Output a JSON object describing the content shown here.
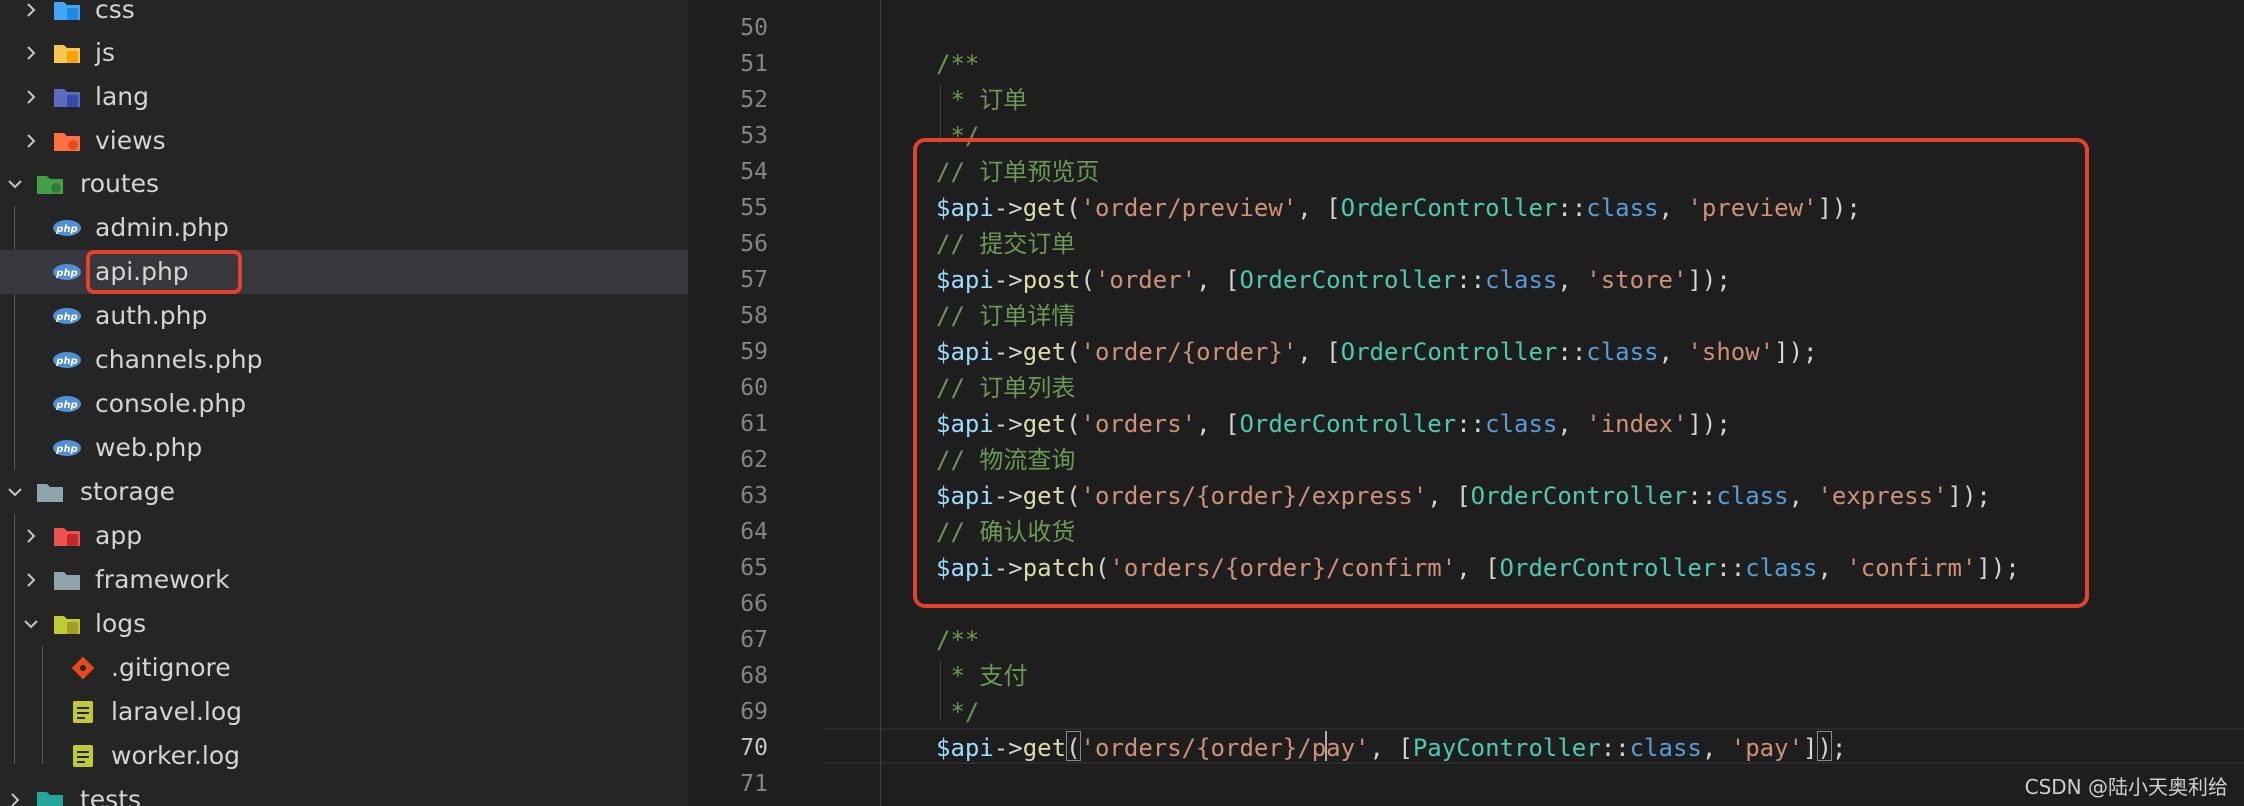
{
  "explorer": {
    "items": [
      {
        "label": "css",
        "type": "folder",
        "icon": "css-folder-icon",
        "expanded": false
      },
      {
        "label": "js",
        "type": "folder",
        "icon": "js-folder-icon",
        "expanded": false
      },
      {
        "label": "lang",
        "type": "folder",
        "icon": "lang-folder-icon",
        "expanded": false
      },
      {
        "label": "views",
        "type": "folder",
        "icon": "views-folder-icon",
        "expanded": false
      },
      {
        "label": "routes",
        "type": "folder",
        "icon": "routes-folder-icon",
        "expanded": true
      },
      {
        "label": "admin.php",
        "type": "file",
        "icon": "php-file-icon"
      },
      {
        "label": "api.php",
        "type": "file",
        "icon": "php-file-icon",
        "selected": true
      },
      {
        "label": "auth.php",
        "type": "file",
        "icon": "php-file-icon"
      },
      {
        "label": "channels.php",
        "type": "file",
        "icon": "php-file-icon"
      },
      {
        "label": "console.php",
        "type": "file",
        "icon": "php-file-icon"
      },
      {
        "label": "web.php",
        "type": "file",
        "icon": "php-file-icon"
      },
      {
        "label": "storage",
        "type": "folder",
        "icon": "storage-folder-icon",
        "expanded": true
      },
      {
        "label": "app",
        "type": "folder",
        "icon": "app-folder-icon",
        "expanded": false
      },
      {
        "label": "framework",
        "type": "folder",
        "icon": "folder-icon",
        "expanded": false
      },
      {
        "label": "logs",
        "type": "folder",
        "icon": "logs-folder-icon",
        "expanded": true
      },
      {
        "label": ".gitignore",
        "type": "file",
        "icon": "git-file-icon"
      },
      {
        "label": "laravel.log",
        "type": "file",
        "icon": "log-file-icon"
      },
      {
        "label": "worker.log",
        "type": "file",
        "icon": "log-file-icon"
      },
      {
        "label": "tests",
        "type": "folder",
        "icon": "tests-folder-icon",
        "expanded": false
      }
    ]
  },
  "editor": {
    "active_line": "70",
    "lines": [
      {
        "n": "50",
        "tokens": []
      },
      {
        "n": "51",
        "tokens": [
          {
            "t": "/**",
            "c": "cmt"
          }
        ]
      },
      {
        "n": "52",
        "tokens": [
          {
            "t": " * 订单",
            "c": "cmt"
          }
        ]
      },
      {
        "n": "53",
        "tokens": [
          {
            "t": " */",
            "c": "cmt"
          }
        ]
      },
      {
        "n": "54",
        "tokens": [
          {
            "t": "// 订单预览页",
            "c": "cmt"
          }
        ]
      },
      {
        "n": "55",
        "tokens": [
          {
            "t": "$api",
            "c": "var"
          },
          {
            "t": "->",
            "c": "op"
          },
          {
            "t": "get",
            "c": "fn"
          },
          {
            "t": "(",
            "c": "op"
          },
          {
            "t": "'order/preview'",
            "c": "str"
          },
          {
            "t": ", [",
            "c": "op"
          },
          {
            "t": "OrderController",
            "c": "cls"
          },
          {
            "t": "::",
            "c": "op"
          },
          {
            "t": "class",
            "c": "kw"
          },
          {
            "t": ", ",
            "c": "op"
          },
          {
            "t": "'preview'",
            "c": "str"
          },
          {
            "t": "]);",
            "c": "op"
          }
        ]
      },
      {
        "n": "56",
        "tokens": [
          {
            "t": "// 提交订单",
            "c": "cmt"
          }
        ]
      },
      {
        "n": "57",
        "tokens": [
          {
            "t": "$api",
            "c": "var"
          },
          {
            "t": "->",
            "c": "op"
          },
          {
            "t": "post",
            "c": "fn"
          },
          {
            "t": "(",
            "c": "op"
          },
          {
            "t": "'order'",
            "c": "str"
          },
          {
            "t": ", [",
            "c": "op"
          },
          {
            "t": "OrderController",
            "c": "cls"
          },
          {
            "t": "::",
            "c": "op"
          },
          {
            "t": "class",
            "c": "kw"
          },
          {
            "t": ", ",
            "c": "op"
          },
          {
            "t": "'store'",
            "c": "str"
          },
          {
            "t": "]);",
            "c": "op"
          }
        ]
      },
      {
        "n": "58",
        "tokens": [
          {
            "t": "// 订单详情",
            "c": "cmt"
          }
        ]
      },
      {
        "n": "59",
        "tokens": [
          {
            "t": "$api",
            "c": "var"
          },
          {
            "t": "->",
            "c": "op"
          },
          {
            "t": "get",
            "c": "fn"
          },
          {
            "t": "(",
            "c": "op"
          },
          {
            "t": "'order/{order}'",
            "c": "str"
          },
          {
            "t": ", [",
            "c": "op"
          },
          {
            "t": "OrderController",
            "c": "cls"
          },
          {
            "t": "::",
            "c": "op"
          },
          {
            "t": "class",
            "c": "kw"
          },
          {
            "t": ", ",
            "c": "op"
          },
          {
            "t": "'show'",
            "c": "str"
          },
          {
            "t": "]);",
            "c": "op"
          }
        ]
      },
      {
        "n": "60",
        "tokens": [
          {
            "t": "// 订单列表",
            "c": "cmt"
          }
        ]
      },
      {
        "n": "61",
        "tokens": [
          {
            "t": "$api",
            "c": "var"
          },
          {
            "t": "->",
            "c": "op"
          },
          {
            "t": "get",
            "c": "fn"
          },
          {
            "t": "(",
            "c": "op"
          },
          {
            "t": "'orders'",
            "c": "str"
          },
          {
            "t": ", [",
            "c": "op"
          },
          {
            "t": "OrderController",
            "c": "cls"
          },
          {
            "t": "::",
            "c": "op"
          },
          {
            "t": "class",
            "c": "kw"
          },
          {
            "t": ", ",
            "c": "op"
          },
          {
            "t": "'index'",
            "c": "str"
          },
          {
            "t": "]);",
            "c": "op"
          }
        ]
      },
      {
        "n": "62",
        "tokens": [
          {
            "t": "// 物流查询",
            "c": "cmt"
          }
        ]
      },
      {
        "n": "63",
        "tokens": [
          {
            "t": "$api",
            "c": "var"
          },
          {
            "t": "->",
            "c": "op"
          },
          {
            "t": "get",
            "c": "fn"
          },
          {
            "t": "(",
            "c": "op"
          },
          {
            "t": "'orders/{order}/express'",
            "c": "str"
          },
          {
            "t": ", [",
            "c": "op"
          },
          {
            "t": "OrderController",
            "c": "cls"
          },
          {
            "t": "::",
            "c": "op"
          },
          {
            "t": "class",
            "c": "kw"
          },
          {
            "t": ", ",
            "c": "op"
          },
          {
            "t": "'express'",
            "c": "str"
          },
          {
            "t": "]);",
            "c": "op"
          }
        ]
      },
      {
        "n": "64",
        "tokens": [
          {
            "t": "// 确认收货",
            "c": "cmt"
          }
        ]
      },
      {
        "n": "65",
        "tokens": [
          {
            "t": "$api",
            "c": "var"
          },
          {
            "t": "->",
            "c": "op"
          },
          {
            "t": "patch",
            "c": "fn"
          },
          {
            "t": "(",
            "c": "op"
          },
          {
            "t": "'orders/{order}/confirm'",
            "c": "str"
          },
          {
            "t": ", [",
            "c": "op"
          },
          {
            "t": "OrderController",
            "c": "cls"
          },
          {
            "t": "::",
            "c": "op"
          },
          {
            "t": "class",
            "c": "kw"
          },
          {
            "t": ", ",
            "c": "op"
          },
          {
            "t": "'confirm'",
            "c": "str"
          },
          {
            "t": "]);",
            "c": "op"
          }
        ]
      },
      {
        "n": "66",
        "tokens": []
      },
      {
        "n": "67",
        "tokens": [
          {
            "t": "/**",
            "c": "cmt"
          }
        ]
      },
      {
        "n": "68",
        "tokens": [
          {
            "t": " * 支付",
            "c": "cmt"
          }
        ]
      },
      {
        "n": "69",
        "tokens": [
          {
            "t": " */",
            "c": "cmt"
          }
        ]
      },
      {
        "n": "70",
        "tokens": [
          {
            "t": "$api",
            "c": "var"
          },
          {
            "t": "->",
            "c": "op"
          },
          {
            "t": "get",
            "c": "fn"
          },
          {
            "t": "(",
            "c": "op"
          },
          {
            "t": "'orders/{order}/pay'",
            "c": "str"
          },
          {
            "t": ", [",
            "c": "op"
          },
          {
            "t": "PayController",
            "c": "cls"
          },
          {
            "t": "::",
            "c": "op"
          },
          {
            "t": "class",
            "c": "kw"
          },
          {
            "t": ", ",
            "c": "op"
          },
          {
            "t": "'pay'",
            "c": "str"
          },
          {
            "t": "]);",
            "c": "op"
          }
        ]
      },
      {
        "n": "71",
        "tokens": []
      }
    ]
  },
  "watermark": "CSDN @陆小天奥利给",
  "colors": {
    "accent_highlight": "#e3432c",
    "background": "#1e1e1e",
    "sidebar": "#252526"
  }
}
